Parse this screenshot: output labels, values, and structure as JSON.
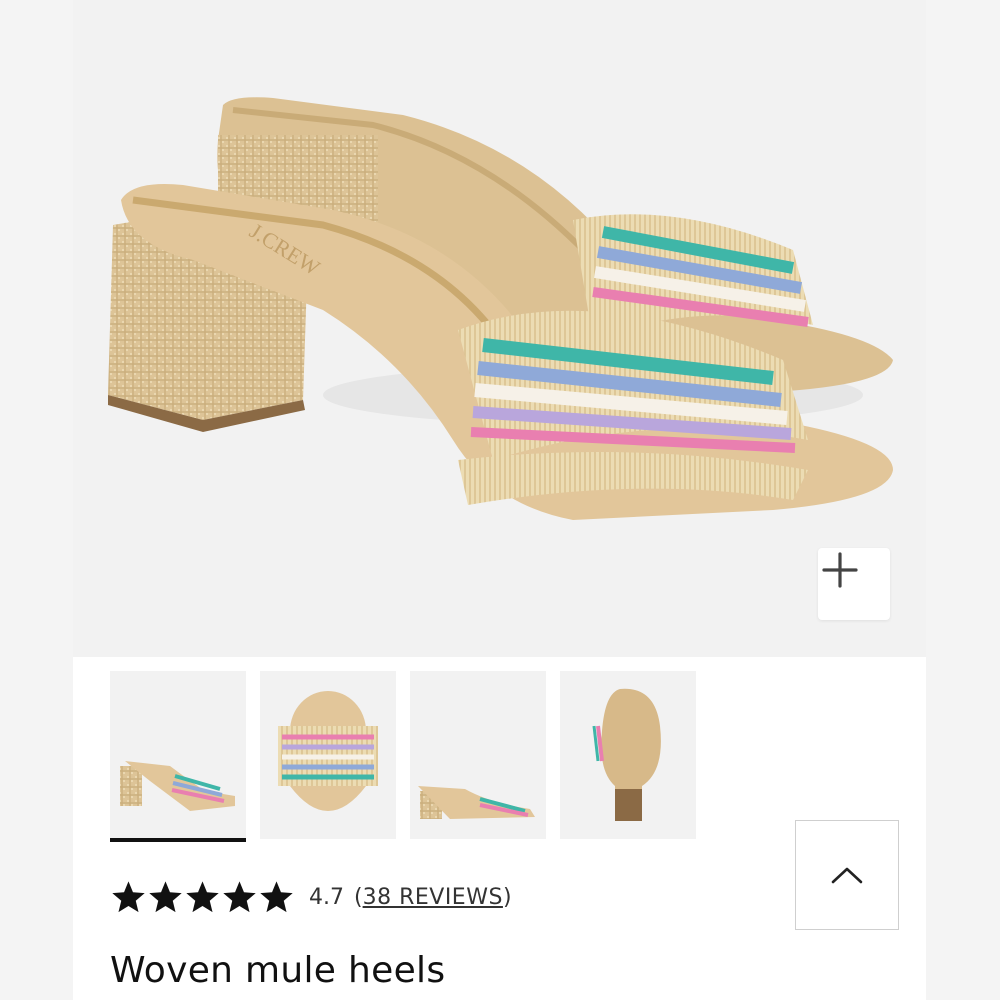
{
  "product": {
    "title": "Woven mule heels",
    "brand_mark": "J.CREW"
  },
  "rating": {
    "value": "4.7",
    "stars": 5,
    "open_paren": "(",
    "reviews_label": "38 REVIEWS",
    "close_paren": ")"
  },
  "gallery": {
    "thumbnails": [
      {
        "name": "side-view",
        "active": true
      },
      {
        "name": "top-view",
        "active": false
      },
      {
        "name": "profile-view",
        "active": false
      },
      {
        "name": "sole-view",
        "active": false
      }
    ]
  },
  "icons": {
    "zoom": "plus-icon",
    "scroll_top": "chevron-up-icon",
    "star": "star-icon"
  },
  "colors": {
    "background": "#efefef",
    "card": "#ffffff",
    "hero_bg": "#f2f2f2",
    "text": "#111111",
    "raffia": "#e3cfa2",
    "footbed": "#e2c69a",
    "stripe_teal": "#3fb6a8",
    "stripe_blue": "#8fa9d8",
    "stripe_lilac": "#b9a6dc",
    "stripe_pink": "#e97fb0"
  }
}
